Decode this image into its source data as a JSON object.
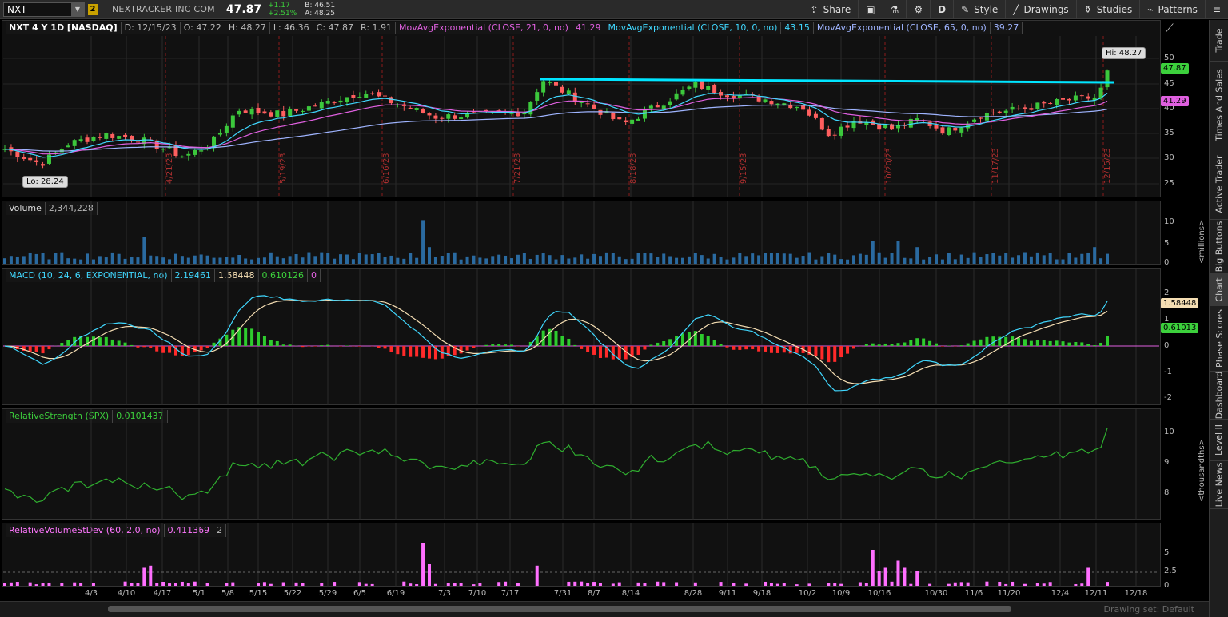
{
  "toolbar": {
    "symbol": "NXT",
    "link_badge": "2",
    "company": "NEXTRACKER INC COM",
    "last": "47.87",
    "change": "+1.17",
    "change_pct": "+2.51%",
    "bid": "B: 46.51",
    "ask": "A: 48.25",
    "share": "Share",
    "period": "D",
    "style": "Style",
    "drawings": "Drawings",
    "studies": "Studies",
    "patterns": "Patterns"
  },
  "right_rail": [
    "Trade",
    "Times And Sales",
    "Active Trader",
    "Big Buttons",
    "Chart",
    "Phase Scores",
    "Dashboard",
    "Level II",
    "Live News"
  ],
  "price_panel": {
    "header": [
      "NXT 4 Y 1D [NASDAQ]",
      "D: 12/15/23",
      "O: 47.22",
      "H: 48.27",
      "L: 46.36",
      "C: 47.87",
      "R: 1.91",
      "MovAvgExponential (CLOSE, 21, 0, no)",
      "41.29",
      "MovAvgExponential (CLOSE, 10, 0, no)",
      "43.15",
      "MovAvgExponential (CLOSE, 65, 0, no)",
      "39.27"
    ],
    "hi_callout": "Hi: 48.27",
    "lo_callout": "Lo: 28.24",
    "last_flag": "47.87",
    "ma_flag": "41.29",
    "y_ticks": [
      "50",
      "45",
      "40",
      "35",
      "30",
      "25"
    ],
    "date_marks": [
      "4/21/23",
      "5/19/23",
      "6/16/23",
      "7/21/23",
      "8/18/23",
      "9/15/23",
      "10/20/23",
      "11/17/23",
      "12/15/23"
    ],
    "colors": {
      "up": "#3cc83c",
      "down": "#ff5f5f",
      "ema21": "#e060e0",
      "ema10": "#40d8ff",
      "ema65": "#9fb4ff",
      "trendline": "#00e5ff"
    }
  },
  "volume_panel": {
    "label": "Volume",
    "value": "2,344,228",
    "y_ticks": [
      "10",
      "5",
      "0"
    ],
    "units": "<millions>"
  },
  "macd_panel": {
    "label": "MACD (10, 24, 6, EXPONENTIAL, no)",
    "values": [
      "2.19461",
      "1.58448",
      "0.610126",
      "0"
    ],
    "y_ticks": [
      "2",
      "1",
      "0",
      "-1",
      "-2"
    ],
    "flag_avg": "1.58448",
    "flag_diff": "0.61013"
  },
  "rs_panel": {
    "label": "RelativeStrength (SPX)",
    "value": "0.0101437",
    "y_ticks": [
      "10",
      "9",
      "8"
    ],
    "units": "<thousandths>"
  },
  "rvs_panel": {
    "label": "RelativeVolumeStDev (60, 2.0, no)",
    "values": [
      "0.411369",
      "2"
    ],
    "y_ticks": [
      "5",
      "2.5",
      "0"
    ]
  },
  "x_axis": [
    "4/3",
    "4/10",
    "4/17",
    "5/1",
    "5/8",
    "5/15",
    "5/22",
    "5/29",
    "6/5",
    "6/19",
    "7/3",
    "7/10",
    "7/17",
    "7/31",
    "8/7",
    "8/14",
    "8/28",
    "9/11",
    "9/18",
    "10/2",
    "10/9",
    "10/16",
    "10/30",
    "11/6",
    "11/20",
    "12/4",
    "12/11",
    "12/18"
  ],
  "drawing_set": "Drawing set: Default"
}
